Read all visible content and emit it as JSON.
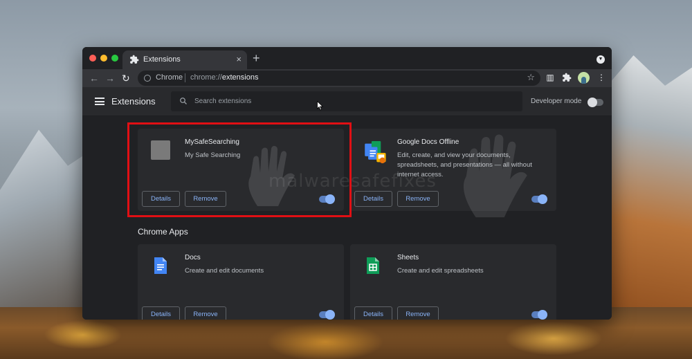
{
  "browser": {
    "tab_title": "Extensions",
    "new_tab_symbol": "+",
    "close_symbol": "×",
    "omnibox_chip": "Chrome",
    "omnibox_url_prefix": "chrome://",
    "omnibox_url_host": "extensions"
  },
  "header": {
    "title": "Extensions",
    "search_placeholder": "Search extensions",
    "developer_mode_label": "Developer mode",
    "developer_mode_on": false
  },
  "extensions": [
    {
      "name": "MySafeSearching",
      "description": "My Safe Searching",
      "details_label": "Details",
      "remove_label": "Remove",
      "enabled": true
    },
    {
      "name": "Google Docs Offline",
      "description": "Edit, create, and view your documents, spreadsheets, and presentations — all without internet access.",
      "details_label": "Details",
      "remove_label": "Remove",
      "enabled": true
    }
  ],
  "apps_section": {
    "title": "Chrome Apps",
    "items": [
      {
        "name": "Docs",
        "description": "Create and edit documents",
        "details_label": "Details",
        "remove_label": "Remove",
        "enabled": true
      },
      {
        "name": "Sheets",
        "description": "Create and edit spreadsheets",
        "details_label": "Details",
        "remove_label": "Remove",
        "enabled": true
      }
    ]
  },
  "watermark_text": "malwaresafefixes",
  "colors": {
    "highlight": "#e10f14",
    "accent": "#8ab4f8",
    "docs_blue": "#4285f4",
    "sheets_green": "#0f9d58"
  }
}
